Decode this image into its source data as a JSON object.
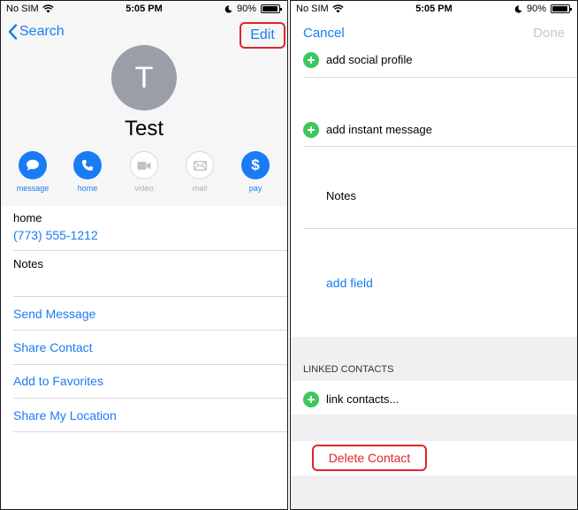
{
  "left": {
    "status": {
      "carrier": "No SIM",
      "time": "5:05 PM",
      "battery": "90%",
      "battery_level": 0.9
    },
    "nav": {
      "back_label": "Search",
      "edit_label": "Edit"
    },
    "contact": {
      "initial": "T",
      "name": "Test"
    },
    "actions": [
      {
        "label": "message",
        "icon": "message-bubble-icon",
        "enabled": true
      },
      {
        "label": "home",
        "icon": "phone-icon",
        "enabled": true
      },
      {
        "label": "video",
        "icon": "video-camera-icon",
        "enabled": false
      },
      {
        "label": "mail",
        "icon": "mail-envelope-icon",
        "enabled": false
      },
      {
        "label": "pay",
        "icon": "dollar-icon",
        "enabled": true
      }
    ],
    "phone_field": {
      "label": "home",
      "value": "(773) 555-1212"
    },
    "notes_label": "Notes",
    "links": [
      "Send Message",
      "Share Contact",
      "Add to Favorites",
      "Share My Location"
    ]
  },
  "right": {
    "status": {
      "carrier": "No SIM",
      "time": "5:05 PM",
      "battery": "90%",
      "battery_level": 0.9
    },
    "nav": {
      "cancel_label": "Cancel",
      "done_label": "Done"
    },
    "add_social_profile": "add social profile",
    "add_instant_message": "add instant message",
    "notes_label": "Notes",
    "add_field": "add field",
    "linked_contacts_header": "LINKED CONTACTS",
    "link_contacts": "link contacts...",
    "delete_contact": "Delete Contact"
  },
  "colors": {
    "accent": "#1a7cf5",
    "destructive": "#e0232a",
    "add_green": "#3cc85a",
    "avatar_grey": "#9a9ea6"
  }
}
